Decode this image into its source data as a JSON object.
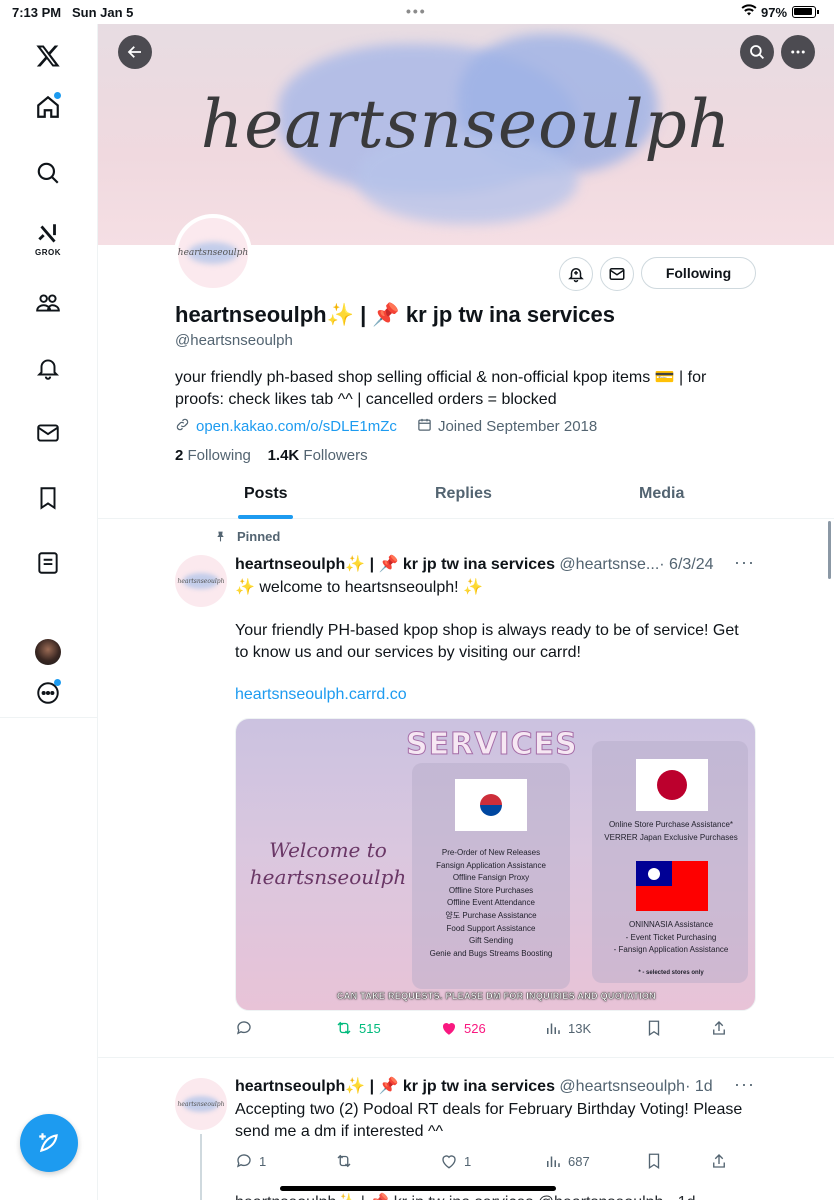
{
  "status_bar": {
    "time": "7:13 PM",
    "date": "Sun Jan 5",
    "battery": "97%"
  },
  "sidebar": {
    "items": [
      "home",
      "explore",
      "grok",
      "communities",
      "notifications",
      "messages",
      "bookmarks",
      "lists",
      "profile",
      "more"
    ],
    "grok_label": "GROK"
  },
  "banner": {
    "title": "heartsnseoulph"
  },
  "profile": {
    "display_name": "heartnseoulph✨ | 📌 kr jp tw ina services",
    "handle": "@heartsnseoulph",
    "bio": "your friendly ph-based shop selling official & non-official kpop items 💳 | for proofs: check likes tab ^^ | cancelled orders = blocked",
    "link": "open.kakao.com/o/sDLE1mZc",
    "joined": "Joined September 2018",
    "following_count": "2",
    "following_label": "Following",
    "followers_count": "1.4K",
    "followers_label": "Followers",
    "follow_button": "Following",
    "avatar_text": "heartsnseoulph"
  },
  "tabs": [
    {
      "label": "Posts",
      "active": true
    },
    {
      "label": "Replies",
      "active": false
    },
    {
      "label": "Media",
      "active": false
    }
  ],
  "posts": [
    {
      "pinned_label": "Pinned",
      "name": "heartnseoulph✨ | 📌 kr jp tw ina services",
      "handle": "@heartsnse...",
      "date": "· 6/3/24",
      "text1": "✨ welcome to heartsnseoulph! ✨",
      "text2": "Your friendly PH-based kpop shop is always ready to be of service! Get to know us and our services by visiting our carrd!",
      "link": "heartsnseoulph.carrd.co",
      "media": {
        "welcome": "Welcome to heartsnseoulph",
        "title": "SERVICES",
        "kr_services": [
          "Pre-Order of New Releases",
          "Fansign Application Assistance",
          "Offline Fansign Proxy",
          "Offline Store Purchases",
          "Offline Event Attendance",
          "양도 Purchase Assistance",
          "Food Support Assistance",
          "Gift Sending",
          "Genie and Bugs Streams Boosting"
        ],
        "jp_services": [
          "Online Store Purchase Assistance*",
          "VERRER Japan Exclusive Purchases"
        ],
        "tw_services": [
          "ONINNASIA Assistance",
          "- Event Ticket Purchasing",
          "- Fansign Application Assistance"
        ],
        "note": "* - selected stores only",
        "footer": "CAN TAKE REQUESTS. PLEASE DM FOR INQUIRIES AND QUOTATION"
      },
      "replies": "",
      "retweets": "515",
      "likes": "526",
      "views": "13K"
    },
    {
      "name": "heartnseoulph✨ | 📌 kr jp tw ina services",
      "handle": "@heartsnseoulph",
      "date": "· 1d",
      "text": "Accepting two (2) Podoal RT deals for February Birthday Voting! Please send me a dm if interested ^^",
      "replies": "1",
      "retweets": "",
      "likes": "1",
      "views": "687"
    }
  ],
  "next_post_preview": "heartnseoulph✨ | 📌 kr jp tw ina services @heartsnseoulph · 1d",
  "colors": {
    "accent": "#1d9bf0",
    "retweet": "#00ba7c",
    "like": "#f91880",
    "text_secondary": "#536471"
  }
}
